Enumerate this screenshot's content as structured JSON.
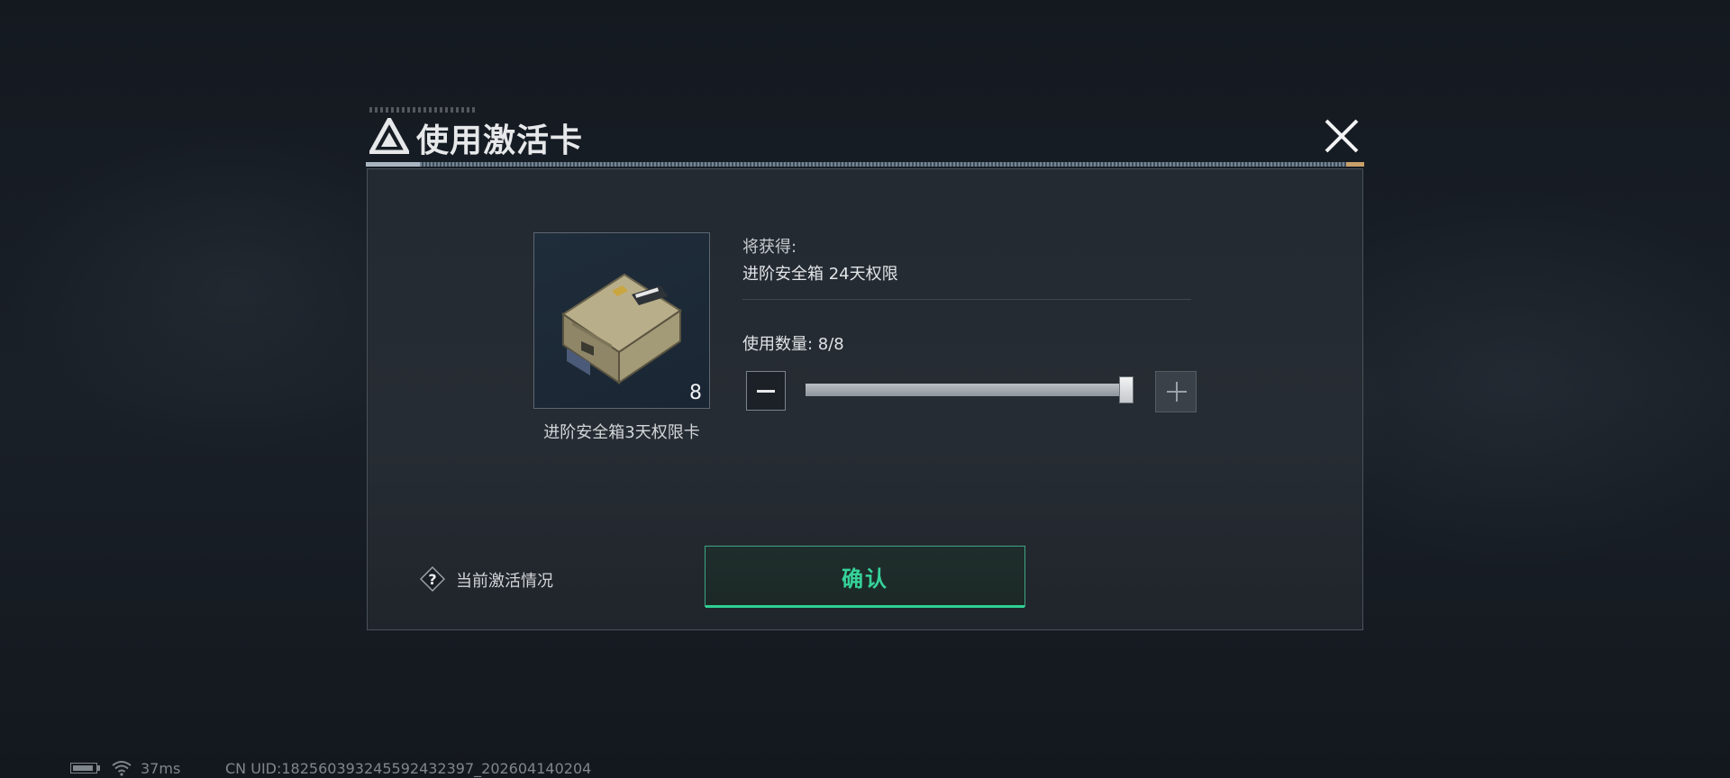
{
  "dialog": {
    "title": "使用激活卡",
    "close_icon": "close-icon"
  },
  "item": {
    "name": "进阶安全箱3天权限卡",
    "count": "8",
    "image_icon": "safe-box-icon"
  },
  "reward": {
    "label": "将获得:",
    "value": "进阶安全箱 24天权限"
  },
  "quantity": {
    "label": "使用数量: 8/8",
    "current": 8,
    "max": 8,
    "fraction": 1.0,
    "minus_icon": "minus-icon",
    "plus_icon": "plus-icon"
  },
  "footer": {
    "help_text": "当前激活情况",
    "help_icon": "question-icon",
    "confirm_label": "确认"
  },
  "status_bar": {
    "ping": "37ms",
    "uid": "CN UID:1825603932455924323​97_202604140204"
  },
  "colors": {
    "accent_green": "#35d39a",
    "panel_bg": "#242a31",
    "page_bg": "#151a20"
  }
}
